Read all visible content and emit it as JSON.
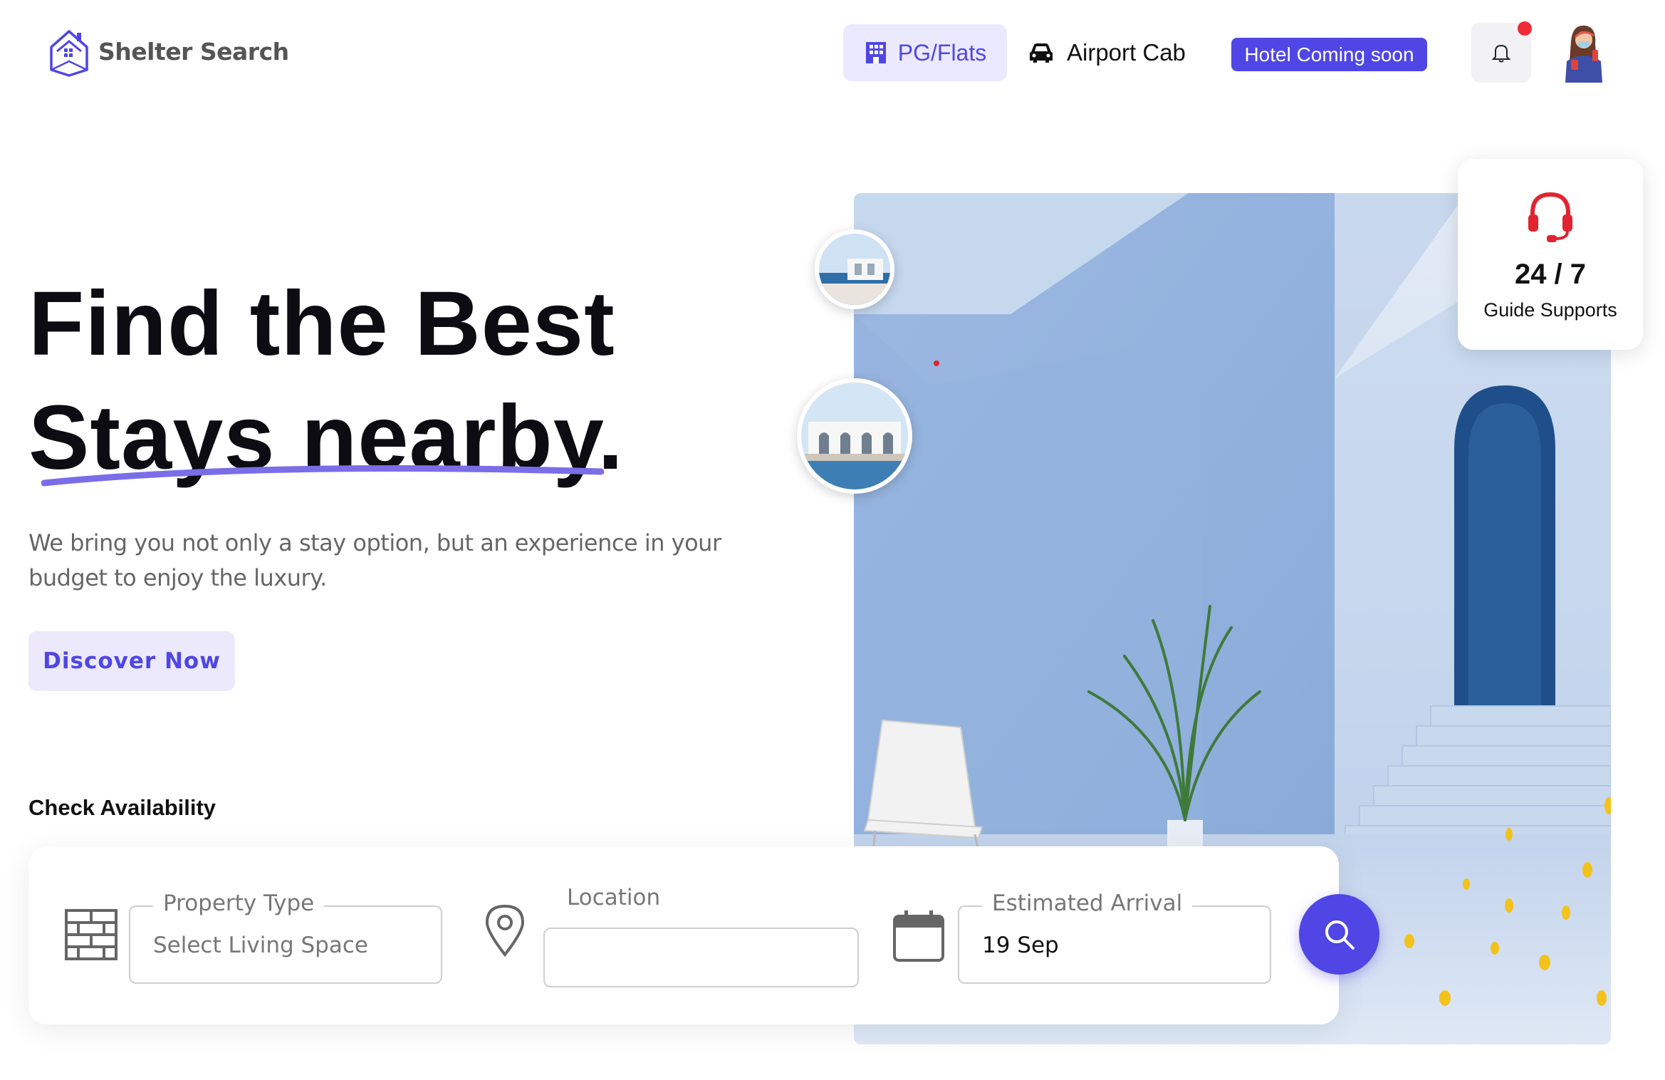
{
  "brand": {
    "name": "Shelter Search"
  },
  "nav": {
    "pg_flats": "PG/Flats",
    "airport_cab": "Airport Cab",
    "hotel_badge": "Hotel Coming soon"
  },
  "hero": {
    "title_line1": "Find the Best",
    "title_line2": "Stays nearby.",
    "subtitle": "We bring you not only a stay option, but an experience in your budget to enjoy the luxury.",
    "cta": "Discover Now"
  },
  "support": {
    "value": "24 / 7",
    "label": "Guide Supports"
  },
  "availability": {
    "title": "Check Availability",
    "property_type": {
      "legend": "Property Type",
      "value": "Select Living Space"
    },
    "location": {
      "legend": "Location",
      "value": ""
    },
    "arrival": {
      "legend": "Estimated Arrival",
      "value": "19 Sep"
    }
  },
  "colors": {
    "accent": "#4f46e5",
    "accent_soft": "#ebe9ff",
    "notification": "#ef2b3a",
    "support_icon": "#e1242f"
  },
  "icons": [
    "house-logo-icon",
    "building-icon",
    "car-icon",
    "bell-icon",
    "headset-icon",
    "brick-wall-icon",
    "map-pin-icon",
    "calendar-icon",
    "search-icon"
  ]
}
